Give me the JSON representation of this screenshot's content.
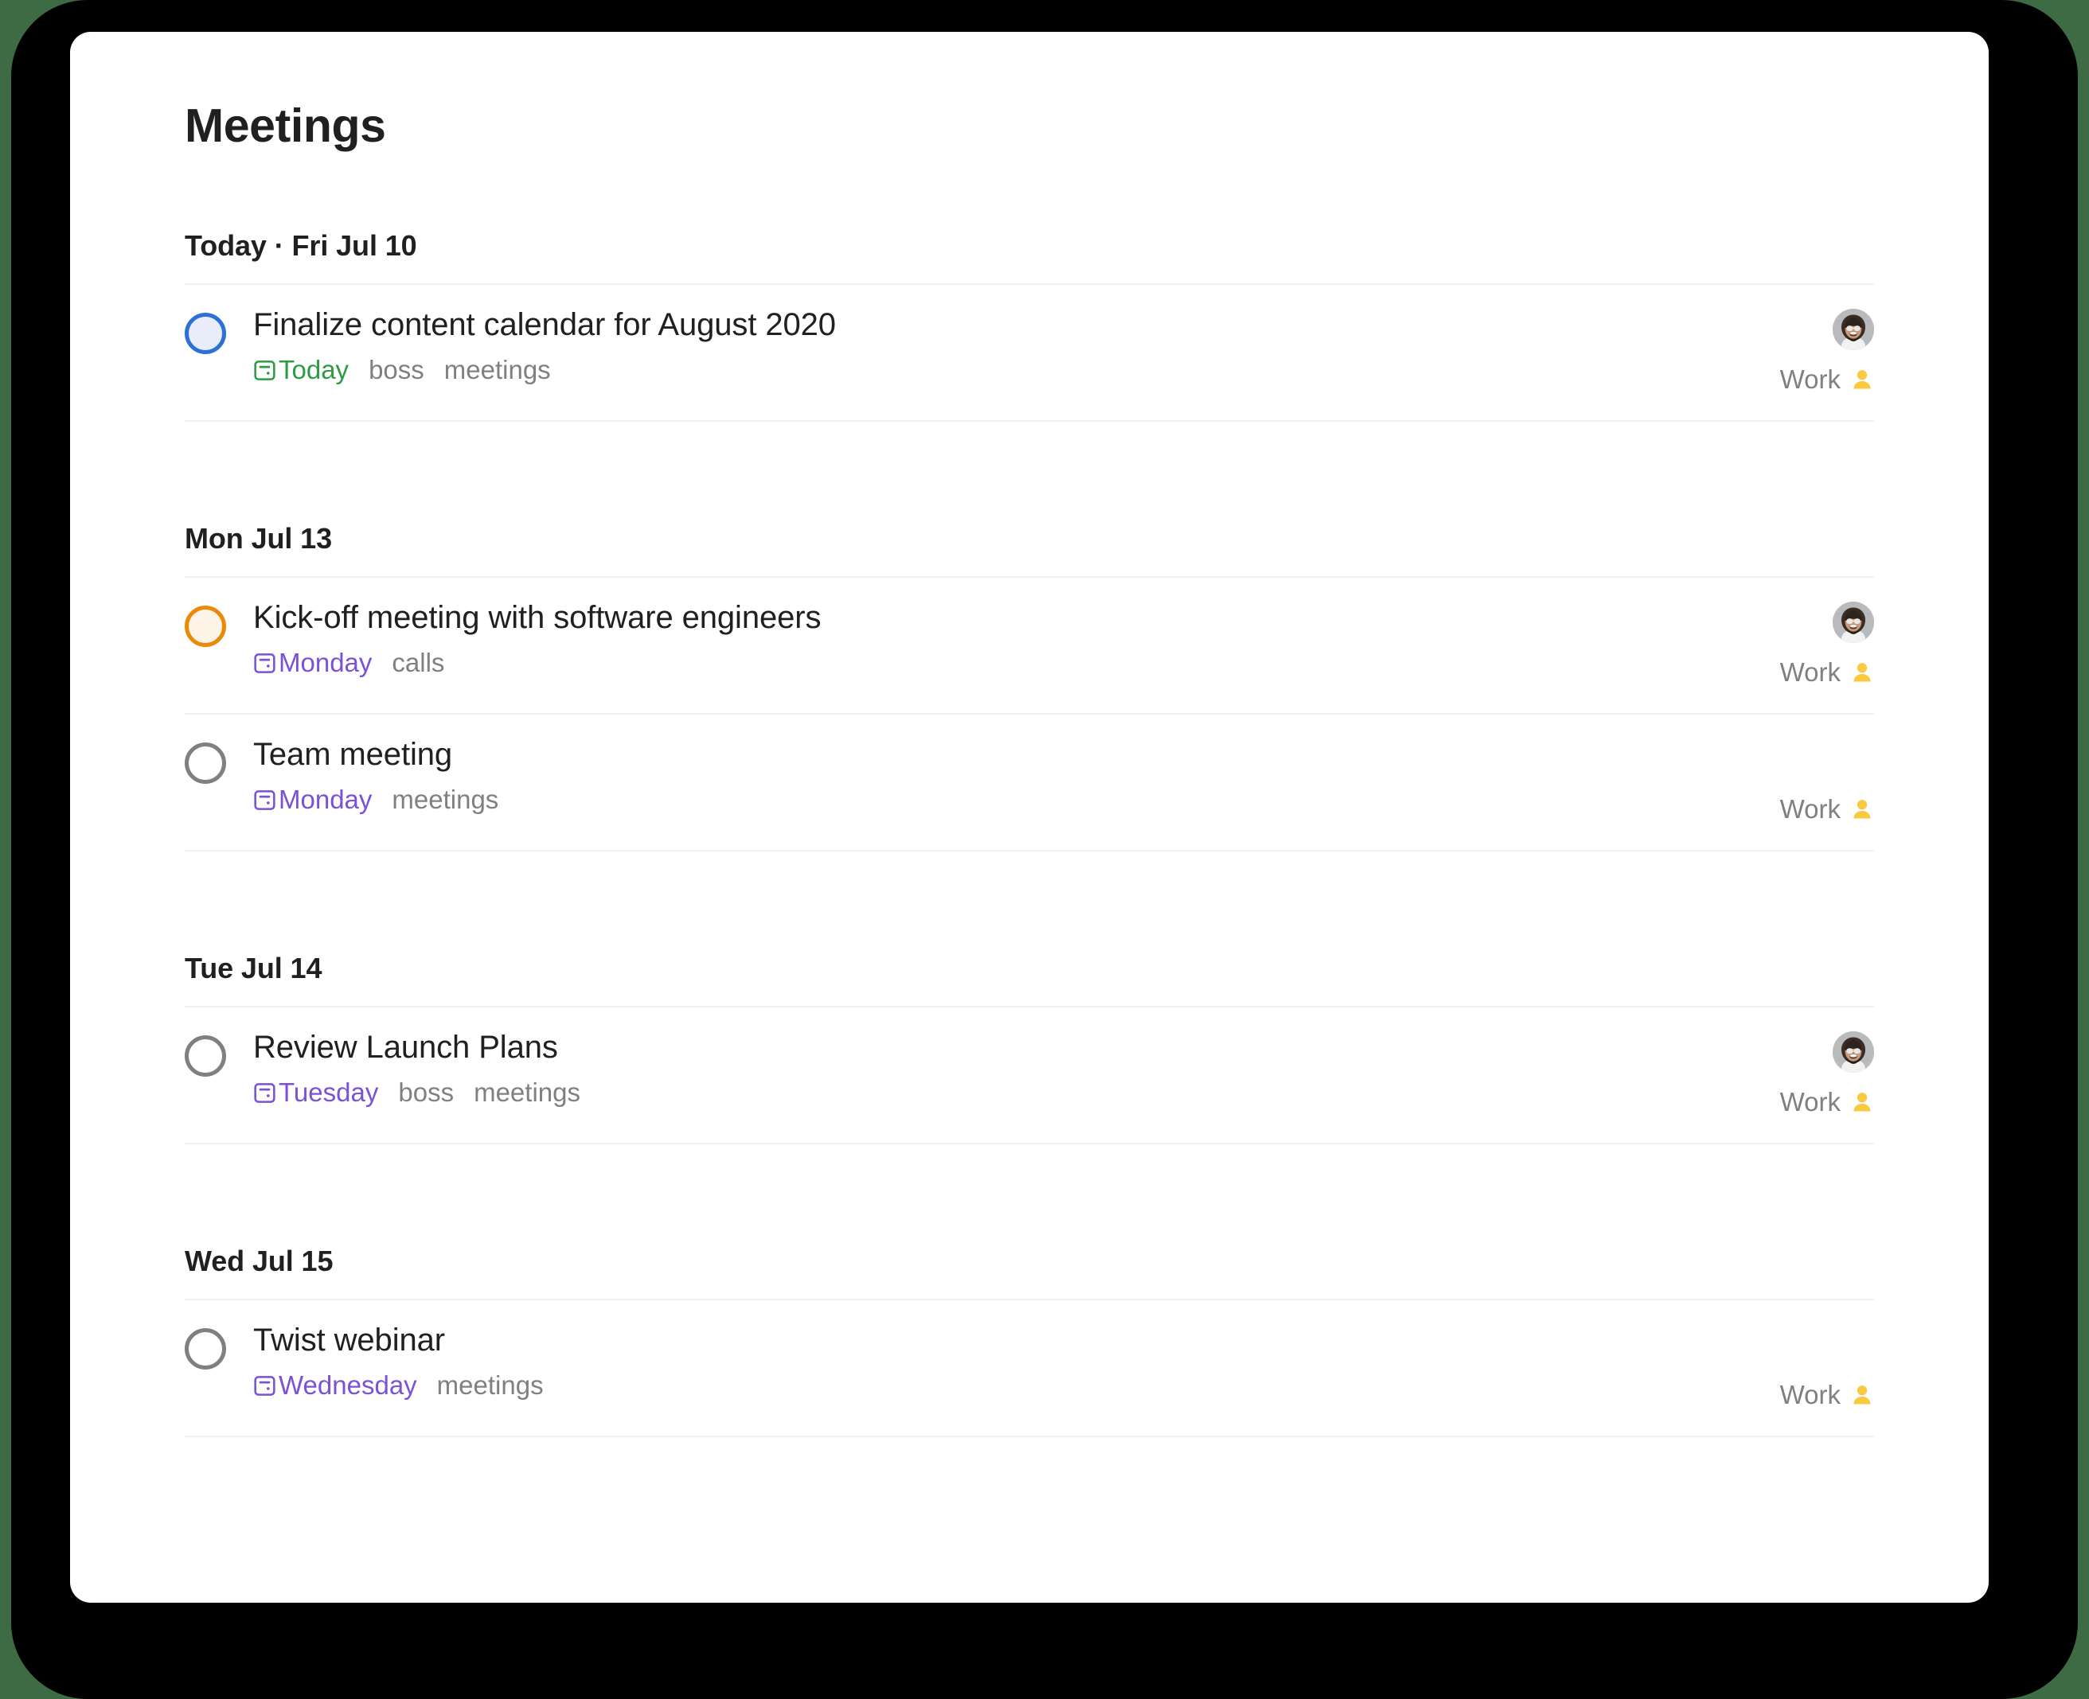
{
  "window": {
    "frame_color": "#000000",
    "backdrop_color": "#3d6b43",
    "card_color": "#ffffff"
  },
  "header": {
    "title": "Meetings"
  },
  "colors": {
    "priority_blue": "#2f70d6",
    "priority_orange": "#eb8909",
    "priority_none": "#808080",
    "due_today_green": "#2c9c43",
    "due_upcoming_purple": "#7b51d8",
    "label_gray": "#808080",
    "project_dot_yellow": "#fbc93f",
    "divider": "#f0f0f0"
  },
  "sections": [
    {
      "header": "Today · Fri Jul 10",
      "tasks": [
        {
          "title": "Finalize content calendar for August 2020",
          "checkbox": "p-blue",
          "due": "Today",
          "due_style": "green",
          "labels": [
            "boss",
            "meetings"
          ],
          "project": "Work",
          "has_avatar": true
        }
      ]
    },
    {
      "header": "Mon Jul 13",
      "tasks": [
        {
          "title": "Kick-off meeting with software engineers",
          "checkbox": "p-orange",
          "due": "Monday",
          "due_style": "purple",
          "labels": [
            "calls"
          ],
          "project": "Work",
          "has_avatar": true
        },
        {
          "title": "Team meeting",
          "checkbox": "p-none",
          "due": "Monday",
          "due_style": "purple",
          "labels": [
            "meetings"
          ],
          "project": "Work",
          "has_avatar": false
        }
      ]
    },
    {
      "header": "Tue Jul 14",
      "tasks": [
        {
          "title": "Review Launch Plans",
          "checkbox": "p-none",
          "due": "Tuesday",
          "due_style": "purple",
          "labels": [
            "boss",
            "meetings"
          ],
          "project": "Work",
          "has_avatar": true
        }
      ]
    },
    {
      "header": "Wed Jul 15",
      "tasks": [
        {
          "title": "Twist webinar",
          "checkbox": "p-none",
          "due": "Wednesday",
          "due_style": "purple",
          "labels": [
            "meetings"
          ],
          "project": "Work",
          "has_avatar": false
        }
      ]
    }
  ],
  "icons": {
    "calendar": "calendar-icon",
    "project_dot": "person-icon",
    "avatar": "user-avatar"
  }
}
